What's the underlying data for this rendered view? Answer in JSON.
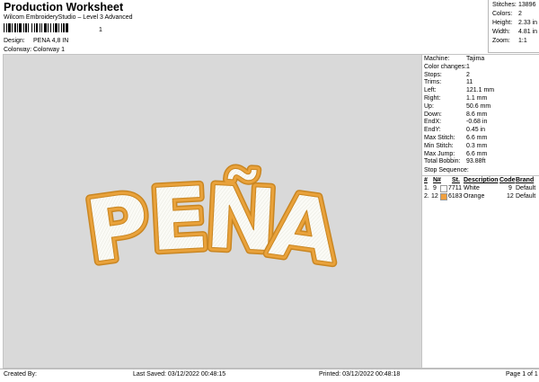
{
  "header": {
    "title": "Production Worksheet",
    "software": "Wilcom EmbroideryStudio – Level 3 Advanced",
    "barcode_caption": "1"
  },
  "meta": [
    {
      "label": "Design:",
      "value": "PENA 4,8 IN"
    },
    {
      "label": "Colorway:",
      "value": "Colorway 1"
    }
  ],
  "stats": [
    {
      "label": "Stitches:",
      "value": "13896"
    },
    {
      "label": "Colors:",
      "value": "2"
    },
    {
      "label": "Height:",
      "value": "2.33 in"
    },
    {
      "label": "Width:",
      "value": "4.81 in"
    },
    {
      "label": "Zoom:",
      "value": "1:1"
    }
  ],
  "design": {
    "text": "PEÑA",
    "fill_color": "#fbfbf6",
    "outline_color": "#e9a23b",
    "outline_dark": "#c98622",
    "background": "#d9d9d9"
  },
  "machine_info": [
    {
      "label": "Machine:",
      "value": "Tajima"
    },
    {
      "label": "Color changes:",
      "value": "1"
    },
    {
      "label": "Stops:",
      "value": "2"
    },
    {
      "label": "Trims:",
      "value": "11"
    },
    {
      "label": "Left:",
      "value": "121.1 mm"
    },
    {
      "label": "Right:",
      "value": "1.1 mm"
    },
    {
      "label": "Up:",
      "value": "50.6 mm"
    },
    {
      "label": "Down:",
      "value": "8.6 mm"
    },
    {
      "label": "EndX:",
      "value": "-0.68 in"
    },
    {
      "label": "EndY:",
      "value": "0.45 in"
    },
    {
      "label": "Max Stitch:",
      "value": "6.6 mm"
    },
    {
      "label": "Min Stitch:",
      "value": "0.3 mm"
    },
    {
      "label": "Max Jump:",
      "value": "6.6 mm"
    },
    {
      "label": "Total Bobbin:",
      "value": "93.88ft"
    }
  ],
  "stop_sequence": {
    "title": "Stop Sequence:",
    "headers": {
      "num": "#",
      "n": "N#",
      "st": "St.",
      "description": "Description",
      "code": "Code",
      "brand": "Brand"
    },
    "rows": [
      {
        "num": "1.",
        "n": "9",
        "color": "#ffffff",
        "st": "7711",
        "description": "White",
        "code": "9",
        "brand": "Default"
      },
      {
        "num": "2.",
        "n": "12",
        "color": "#f0a040",
        "st": "6183",
        "description": "Orange",
        "code": "12",
        "brand": "Default"
      }
    ]
  },
  "footer": {
    "created_by": "Created By:",
    "last_saved": "Last Saved: 03/12/2022 00:48:15",
    "printed": "Printed: 03/12/2022 00:48:18",
    "page": "Page 1 of 1"
  }
}
